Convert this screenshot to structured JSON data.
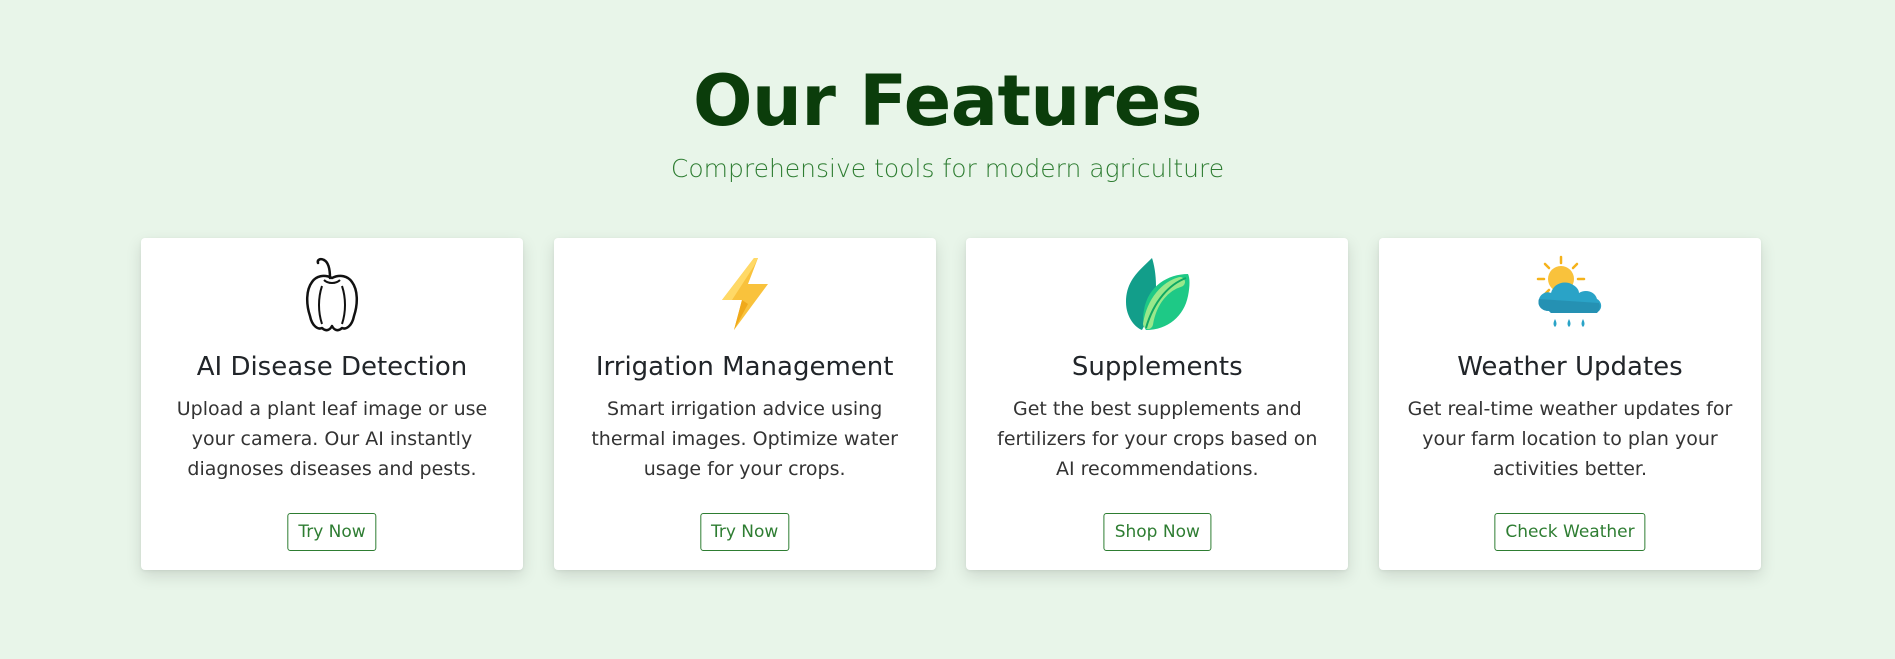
{
  "header": {
    "title": "Our Features",
    "subtitle": "Comprehensive tools for modern agriculture"
  },
  "cards": [
    {
      "icon": "bell-pepper-icon",
      "title": "AI Disease Detection",
      "text": "Upload a plant leaf image or use your camera. Our AI instantly diagnoses diseases and pests.",
      "button": "Try Now"
    },
    {
      "icon": "lightning-bolt-icon",
      "title": "Irrigation Management",
      "text": "Smart irrigation advice using thermal images. Optimize water usage for your crops.",
      "button": "Try Now"
    },
    {
      "icon": "leaf-icon",
      "title": "Supplements",
      "text": "Get the best supplements and fertilizers for your crops based on AI recommendations.",
      "button": "Shop Now"
    },
    {
      "icon": "sun-cloud-rain-icon",
      "title": "Weather Updates",
      "text": "Get real-time weather updates for your farm location to plan your activities better.",
      "button": "Check Weather"
    }
  ],
  "colors": {
    "background": "#e8f5e9",
    "title": "#0b3d0b",
    "accent": "#2e7d32"
  }
}
